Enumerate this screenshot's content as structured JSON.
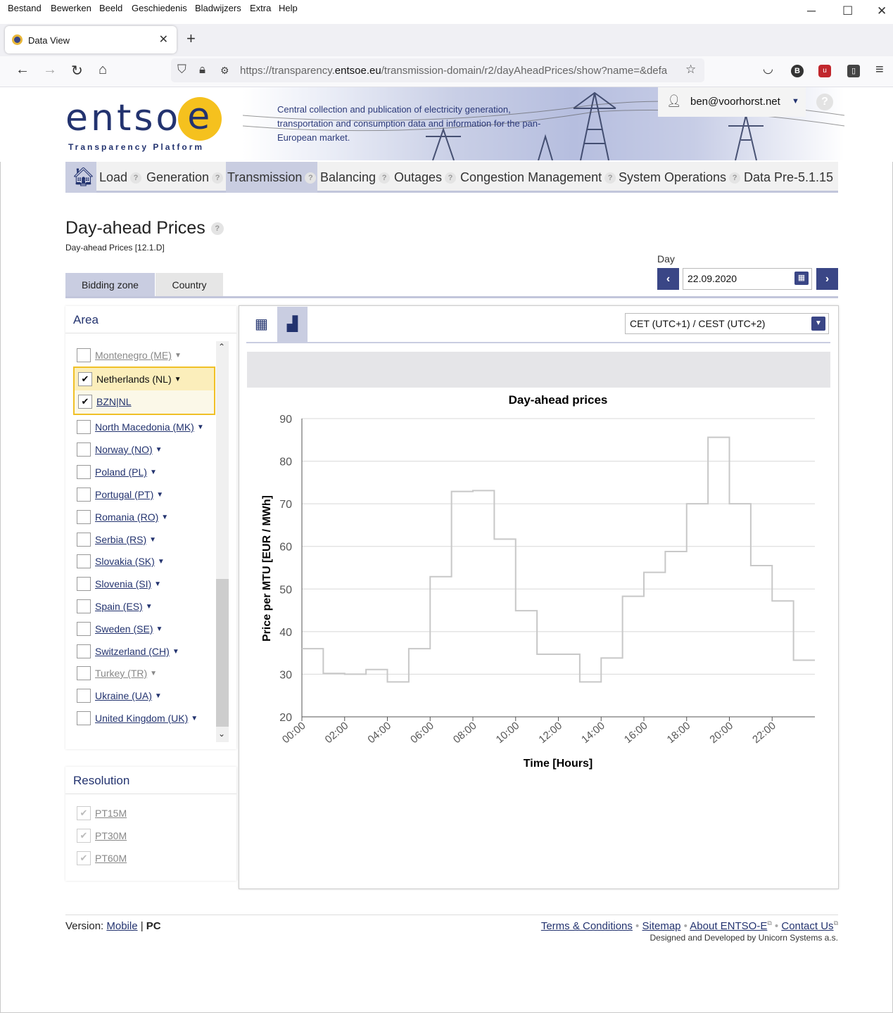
{
  "browser": {
    "menu": [
      "Bestand",
      "Bewerken",
      "Beeld",
      "Geschiedenis",
      "Bladwijzers",
      "Extra",
      "Help"
    ],
    "tab_title": "Data View",
    "url_prefix": "https://transparency.",
    "url_domain": "entsoe.eu",
    "url_path": "/transmission-domain/r2/dayAheadPrices/show?name=&defa"
  },
  "header": {
    "logo_text": "entso",
    "logo_e": "e",
    "logo_sub": "Transparency Platform",
    "tagline": "Central collection and publication of electricity generation, transportation and consumption data and information for the pan-European market.",
    "user": "ben@voorhorst.net"
  },
  "nav": {
    "items": [
      {
        "label": "Load"
      },
      {
        "label": "Generation"
      },
      {
        "label": "Transmission"
      },
      {
        "label": "Balancing"
      },
      {
        "label": "Outages"
      },
      {
        "label": "Congestion Management"
      },
      {
        "label": "System Operations"
      },
      {
        "label": "Data Pre-5.1.15"
      }
    ]
  },
  "page": {
    "title": "Day-ahead Prices",
    "subtitle": "Day-ahead Prices [12.1.D]",
    "day_label": "Day",
    "day_value": "22.09.2020",
    "tabs": [
      "Bidding zone",
      "Country"
    ],
    "timezone": "CET (UTC+1) / CEST (UTC+2)"
  },
  "area": {
    "heading": "Area",
    "items": [
      {
        "label": "Montenegro (ME)",
        "checked": false,
        "disabled": true
      },
      {
        "label": "Netherlands (NL)",
        "checked": true,
        "disabled": false
      },
      {
        "label": "BZN|NL",
        "checked": true,
        "disabled": false
      },
      {
        "label": "North Macedonia (MK)",
        "checked": false,
        "disabled": false
      },
      {
        "label": "Norway (NO)",
        "checked": false,
        "disabled": false
      },
      {
        "label": "Poland (PL)",
        "checked": false,
        "disabled": false
      },
      {
        "label": "Portugal (PT)",
        "checked": false,
        "disabled": false
      },
      {
        "label": "Romania (RO)",
        "checked": false,
        "disabled": false
      },
      {
        "label": "Serbia (RS)",
        "checked": false,
        "disabled": false
      },
      {
        "label": "Slovakia (SK)",
        "checked": false,
        "disabled": false
      },
      {
        "label": "Slovenia (SI)",
        "checked": false,
        "disabled": false
      },
      {
        "label": "Spain (ES)",
        "checked": false,
        "disabled": false
      },
      {
        "label": "Sweden (SE)",
        "checked": false,
        "disabled": false
      },
      {
        "label": "Switzerland (CH)",
        "checked": false,
        "disabled": false
      },
      {
        "label": "Turkey (TR)",
        "checked": false,
        "disabled": true
      },
      {
        "label": "Ukraine (UA)",
        "checked": false,
        "disabled": false
      },
      {
        "label": "United Kingdom (UK)",
        "checked": false,
        "disabled": false
      }
    ]
  },
  "resolution": {
    "heading": "Resolution",
    "items": [
      "PT15M",
      "PT30M",
      "PT60M"
    ]
  },
  "chart_data": {
    "type": "line",
    "step": true,
    "title": "Day-ahead prices",
    "xlabel": "Time [Hours]",
    "ylabel": "Price per MTU [EUR / MWh]",
    "x_tick_labels": [
      "00:00",
      "02:00",
      "04:00",
      "06:00",
      "08:00",
      "10:00",
      "12:00",
      "14:00",
      "16:00",
      "18:00",
      "20:00",
      "22:00"
    ],
    "y_ticks": [
      20,
      30,
      40,
      50,
      60,
      70,
      80,
      90
    ],
    "ylim": [
      20,
      90
    ],
    "xlim": [
      0,
      24
    ],
    "hours": [
      0,
      1,
      2,
      3,
      4,
      5,
      6,
      7,
      8,
      9,
      10,
      11,
      12,
      13,
      14,
      15,
      16,
      17,
      18,
      19,
      20,
      21,
      22,
      23
    ],
    "values": [
      36.0,
      30.2,
      30.0,
      31.1,
      28.2,
      36.0,
      52.9,
      72.9,
      73.1,
      61.7,
      44.9,
      34.7,
      34.7,
      28.2,
      33.8,
      48.3,
      53.9,
      58.8,
      70.0,
      85.6,
      70.0,
      55.5,
      47.2,
      33.3
    ],
    "grid": true,
    "line_color": "#c8c8c8"
  },
  "footer": {
    "version_label": "Version:",
    "mobile": "Mobile",
    "pc": "PC",
    "links": [
      "Terms & Conditions",
      "Sitemap",
      "About ENTSO-E",
      "Contact Us"
    ],
    "designed": "Designed and Developed by Unicorn Systems a.s."
  }
}
